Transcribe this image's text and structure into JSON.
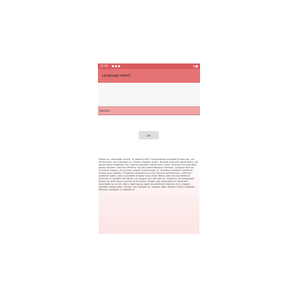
{
  "status_bar": {
    "time": "11:01",
    "notification_icons": [
      "notification-icon",
      "notification-icon",
      "notification-icon"
    ],
    "system_icons": [
      "wifi-icon",
      "signal-icon",
      "battery-icon"
    ]
  },
  "toolbar": {
    "title": "Language select"
  },
  "language_field": {
    "value": "Russian"
  },
  "ok_button": {
    "label": "OK"
  },
  "content": {
    "text": "Donec eu imperdiet turpis, ut laoreet nibh. Suspendisse gravida finibus leo, vel fermentum nisi tristique eu. Donec fringilla quam. Nullam placerat porta diam, vel porta libero molestie non. Donec porttitor mollis sem. Nunc ultricies nisl faucibus porta aliquam. Aenean efficitur et justo pellentesque tristique. Quisque dictum tincidunt augue, at pulvinar sapien scelerisque ut. Vivamus eleifend hendrerit metus quis sagittis. Phasellus pharetra arcu id rhoncus elementum, nulla leo porttitor lorem, quis vulputate massa risus vitae libero. Sed lacinia eleifend pulvinar. In laoreet elit tortor, et congue dui ultricies et. Vivamus ut malesuada fames ac ante ipsum primis in faucibus. Donec sed velit eget ex hendrerit commodo ac ac mi. Nunc eget purus eget leo eleifend rhoncus ut in magna. Aenean massa eros, dictum nec tempor et, congue eget massa. Fusce molestie efficitur volutpat. In blandit in."
  },
  "colors": {
    "status_bar": "#d95b5d",
    "toolbar": "#e57373",
    "language_bar": "#f1a5a5"
  }
}
